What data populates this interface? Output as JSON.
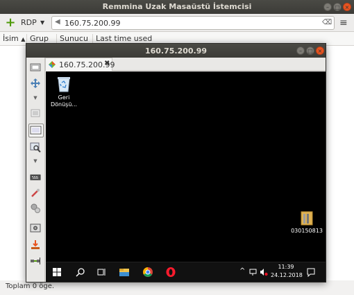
{
  "window": {
    "title": "Remmina Uzak Masaüstü İstemcisi"
  },
  "toolbar": {
    "add_icon": "plus-icon",
    "protocol": "RDP",
    "address": "160.75.200.99",
    "clear_icon": "clear-icon",
    "menu_icon": "hamburger-menu-icon"
  },
  "columns": [
    "İsim",
    "Grup",
    "Sunucu",
    "Last time used"
  ],
  "status": "Toplam 0 öge.",
  "remote": {
    "title": "160.75.200.99",
    "tab_label": "160.75.200.99",
    "tools": [
      "resize-window-icon",
      "toggle-fullscreen-icon",
      "dropdown-icon",
      "auto-fit-icon",
      "scaled-mode-icon",
      "zoom-icon",
      "dropdown-icon",
      "keyboard-grab-icon",
      "preferences-icon",
      "tools-icon",
      "screenshot-icon",
      "minimize-icon",
      "disconnect-icon"
    ],
    "desktop": {
      "recycle_bin_label_1": "Geri",
      "recycle_bin_label_2": "Dönüşü...",
      "folder_label": "030150813",
      "clock_time": "11:39",
      "clock_date": "24.12.2018"
    },
    "accent": "#e95420"
  }
}
